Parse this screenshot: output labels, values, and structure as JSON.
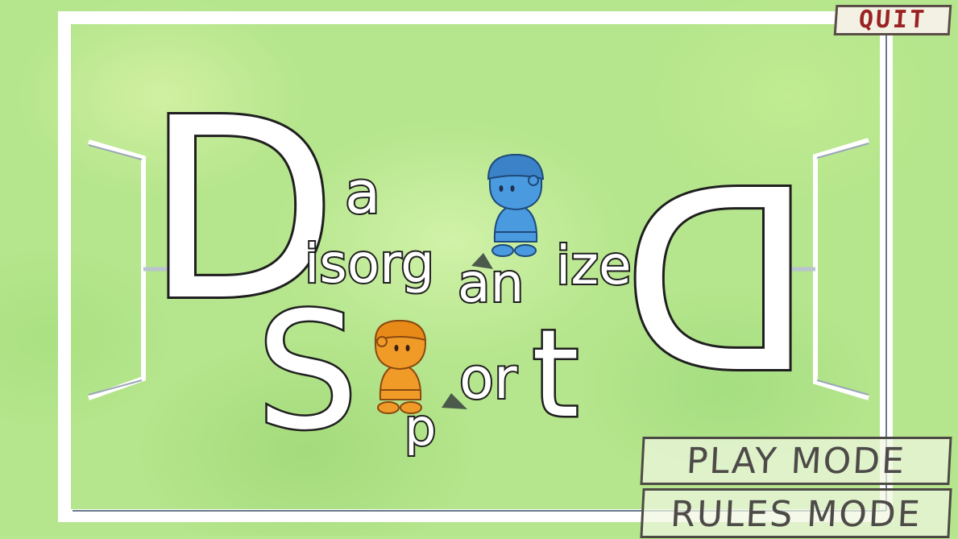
{
  "menu": {
    "quit_label": "QUIT",
    "play_mode_label": "PLAY MODE",
    "rules_mode_label": "RULES MODE"
  },
  "title": {
    "letters_D": "D",
    "word_a": "a",
    "letters_isorg": "isorg",
    "letters_an": "an",
    "letters_ize": "ize",
    "letters_S": "S",
    "letters_p": "p",
    "letters_ort": "ort"
  },
  "colors": {
    "field_green": "#b5e58c",
    "line_white": "#ffffff",
    "blue_player": "#4a9ae0",
    "orange_player": "#f09a28",
    "quit_text": "#9a2222",
    "button_text": "#4d4a48"
  },
  "icons": [
    "blue-player-icon",
    "orange-player-icon",
    "goal-left-icon",
    "goal-right-icon",
    "triangle-marker-icon"
  ]
}
